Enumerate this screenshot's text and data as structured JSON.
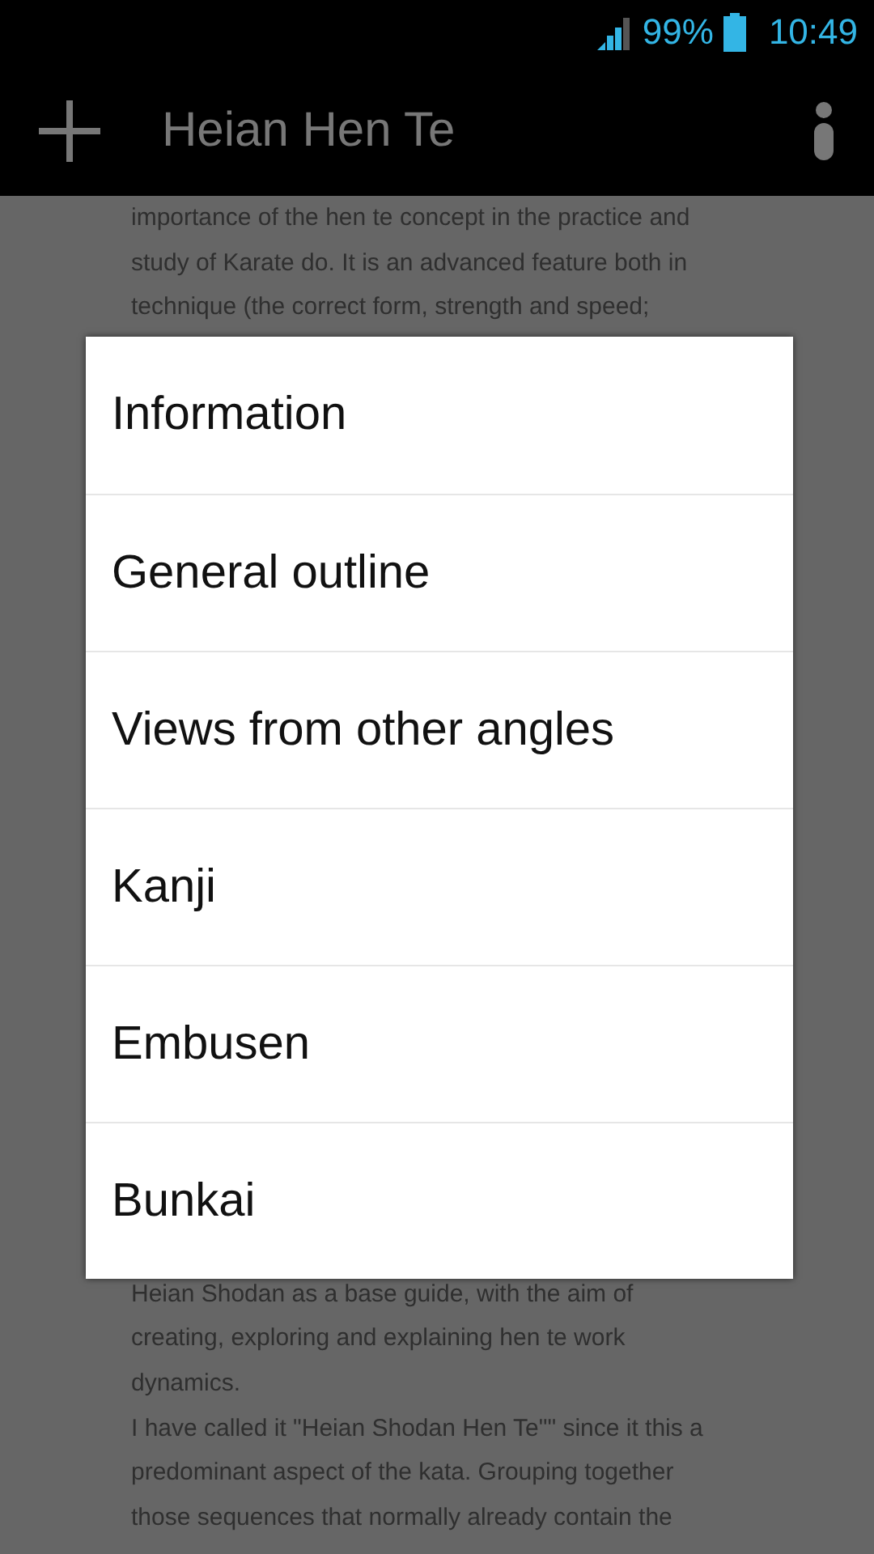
{
  "status_bar": {
    "battery": "99%",
    "time": "10:49"
  },
  "action_bar": {
    "title": "Heian Hen Te"
  },
  "body_top_lines": [
    "importance of the hen te concept in the practice and",
    "study of Karate do. It is an advanced feature both in",
    "technique (the correct form, strength and speed;"
  ],
  "body_bottom_lines": [
    "Heian Shodan as a base guide, with the aim of",
    "creating, exploring and explaining hen te work",
    "dynamics.",
    "I have called it \"Heian Shodan Hen Te\"\" since it this a",
    "predominant aspect of the kata. Grouping together",
    "those sequences that normally already contain the"
  ],
  "menu": {
    "items": [
      "Information",
      "General outline",
      "Views from other angles",
      "Kanji",
      "Embusen",
      "Bunkai"
    ]
  }
}
